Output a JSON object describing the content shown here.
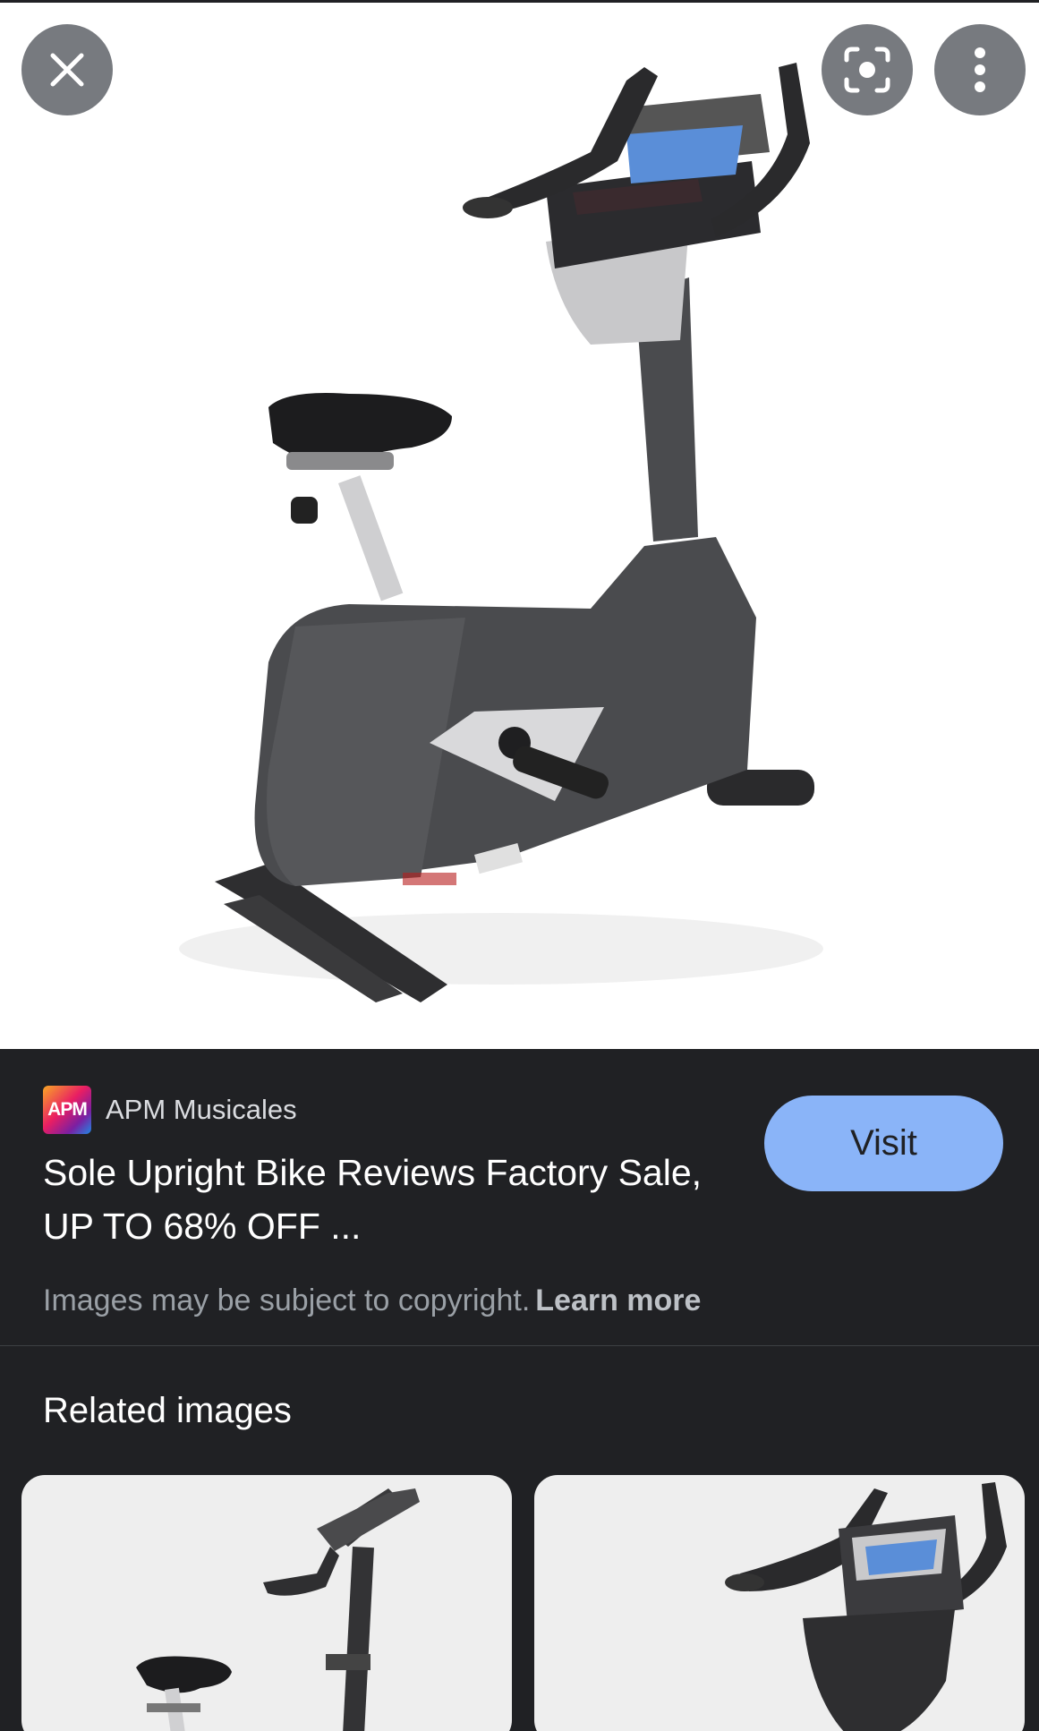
{
  "viewer": {
    "close_icon": "close-icon",
    "lens_icon": "lens-icon",
    "more_icon": "more-vert-icon"
  },
  "result": {
    "favicon_text": "APM",
    "source": "APM Musicales",
    "title": "Sole Upright Bike Reviews Factory Sale, UP TO 68% OFF ...",
    "visit_label": "Visit",
    "copyright_text": "Images may be subject to copyright.",
    "learn_more": "Learn more"
  },
  "related": {
    "heading": "Related images"
  },
  "colors": {
    "background": "#202124",
    "visit_button": "#8ab4f8"
  }
}
